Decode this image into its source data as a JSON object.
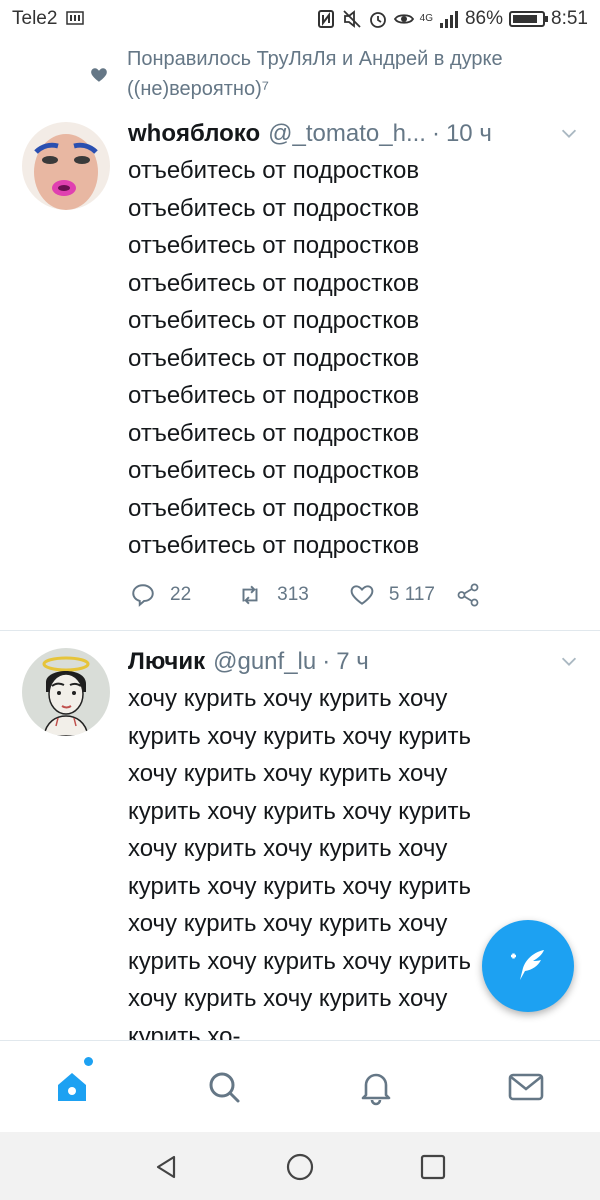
{
  "status_bar": {
    "carrier": "Tele2",
    "network": "4G",
    "battery": "86%",
    "battery_level": 0.86,
    "time": "8:51"
  },
  "social_context": {
    "text": "Понравилось ТруЛяЛя и Андрей в дурке ((не)вероятно)⁷",
    "icon": "heart-icon"
  },
  "tweets": [
    {
      "name": "whoяблоко",
      "handle": "@_tomato_h...",
      "dot": "·",
      "time": "10 ч",
      "lines": [
        "отъебитесь от подростков",
        "отъебитесь от подростков",
        "отъебитесь от подростков",
        "отъебитесь от подростков",
        "отъебитесь от подростков",
        "отъебитесь от подростков",
        "отъебитесь от подростков",
        "отъебитесь от подростков",
        "отъебитесь от подростков",
        "отъебитесь от подростков",
        "отъебитесь от подростков"
      ],
      "replies": "22",
      "retweets": "313",
      "likes": "5 117"
    },
    {
      "name": "Лючик",
      "handle": "@gunf_lu",
      "dot": "·",
      "time": "7 ч",
      "lines": [
        "хочу курить хочу курить хочу",
        "курить хочу курить хочу курить",
        "хочу курить хочу курить хочу",
        "курить хочу курить хочу курить",
        "хочу курить хочу курить хочу",
        "курить хочу курить хочу курить",
        "хочу курить хочу курить хочу",
        "курить хочу курить хочу курить",
        "хочу курить хочу курить хочу",
        "курить хо-"
      ]
    }
  ],
  "colors": {
    "accent": "#1da1f2",
    "muted": "#657786",
    "text": "#14171a",
    "divider": "#e1e8ed"
  },
  "tabs": [
    "home-icon",
    "search-icon",
    "notifications-icon",
    "messages-icon"
  ],
  "system_nav": [
    "back-icon",
    "home-circle-icon",
    "recents-icon"
  ]
}
